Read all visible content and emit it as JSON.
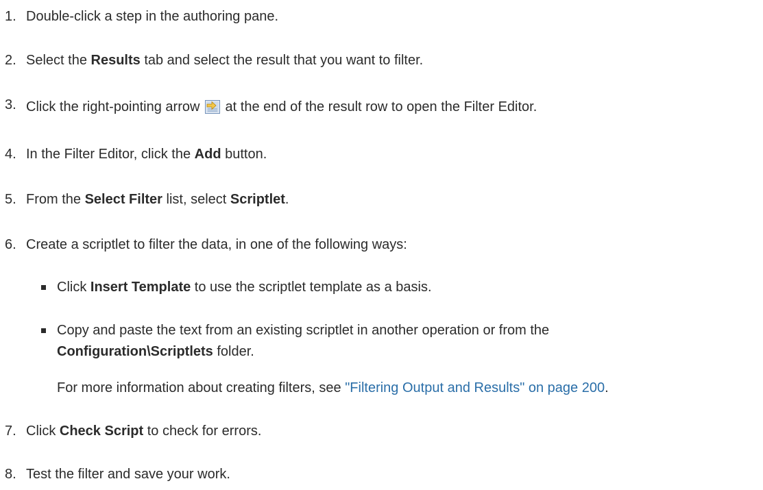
{
  "steps": [
    {
      "num": "1.",
      "text": "Double-click a step in the authoring pane."
    },
    {
      "num": "2.",
      "pre": "Select the ",
      "b1": "Results",
      "post": " tab and select the result that you want to filter."
    },
    {
      "num": "3.",
      "pre": "Click the right-pointing arrow",
      "post": " at the end of the result row to open the Filter Editor."
    },
    {
      "num": "4.",
      "pre": "In the Filter Editor, click the ",
      "b1": "Add",
      "post": " button."
    },
    {
      "num": "5.",
      "pre": "From the ",
      "b1": "Select Filter",
      "mid": " list, select ",
      "b2": "Scriptlet",
      "post": "."
    },
    {
      "num": "6.",
      "text": "Create a scriptlet to filter the data, in one of the following ways:"
    },
    {
      "num": "7.",
      "pre": "Click ",
      "b1": "Check Script",
      "post": " to check for errors."
    },
    {
      "num": "8.",
      "text": "Test the filter and save your work."
    }
  ],
  "sub": [
    {
      "pre": "Click ",
      "b1": "Insert Template",
      "post": " to use the scriptlet template as a basis."
    },
    {
      "line1": "Copy and paste the text from an existing scriptlet in another operation or from the",
      "b1": "Configuration\\Scriptlets",
      "post": " folder."
    }
  ],
  "more": {
    "pre": "For more information about creating filters, see ",
    "link": "\"Filtering Output and Results\" on page 200",
    "post": "."
  },
  "icons": {
    "arrow": "right-arrow-filter-icon"
  },
  "colors": {
    "text": "#2b2b2b",
    "link": "#2a6ea8"
  }
}
